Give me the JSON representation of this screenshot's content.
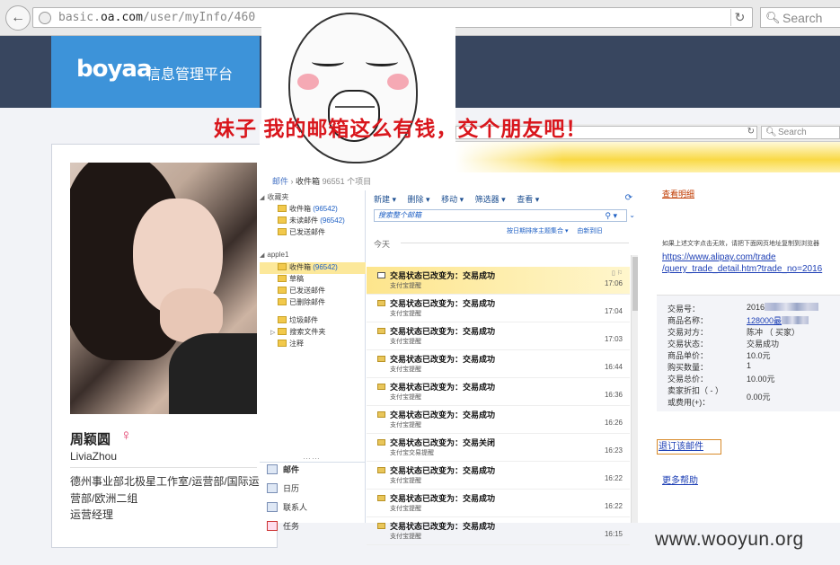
{
  "browser": {
    "url_prefix": "basic.",
    "url_domain": "oa.com",
    "url_path": "/user/myInfo/460",
    "search_placeholder": "Search"
  },
  "header": {
    "brand": "boyaa",
    "title": "信息管理平台"
  },
  "profile": {
    "name": "周颖圆",
    "gender_symbol": "♀",
    "english_name": "LiviaZhou",
    "department": "德州事业部北极星工作室/运营部/国际运营部/欧洲二组",
    "position": "运营经理"
  },
  "meme": {
    "caption": "妹子 我的邮箱这么有钱，交个朋友吧！"
  },
  "inner_browser": {
    "search_placeholder": "Search"
  },
  "outlook": {
    "breadcrumb": {
      "part1": "邮件",
      "sep": "›",
      "part2": "收件箱",
      "count": "96551 个项目"
    },
    "nav": {
      "favorites_label": "收藏夹",
      "inbox": "收件箱",
      "inbox_count": "(96542)",
      "unread": "未读邮件",
      "unread_count": "(96542)",
      "sent": "已发送邮件",
      "account": "apple1",
      "acc_inbox": "收件箱",
      "acc_inbox_count": "(96542)",
      "drafts": "草稿",
      "acc_sent": "已发送邮件",
      "deleted": "已删除邮件",
      "junk": "垃圾邮件",
      "search_folders": "搜索文件夹",
      "notes": "注释"
    },
    "modules": {
      "dots": "……",
      "mail": "邮件",
      "calendar": "日历",
      "contacts": "联系人",
      "tasks": "任务"
    },
    "toolbar": {
      "new": "新建 ▾",
      "delete": "删除 ▾",
      "move": "移动 ▾",
      "filter": "筛选器 ▾",
      "view": "查看 ▾"
    },
    "search_placeholder": "搜索整个邮箱",
    "sort": {
      "by": "按日期排序主题集合 ▾",
      "order": "由新到旧"
    },
    "today_label": "今天",
    "mails": [
      {
        "subject": "交易状态已改变为：交易成功",
        "from": "支付宝提醒",
        "time": "17:06"
      },
      {
        "subject": "交易状态已改变为：交易成功",
        "from": "支付宝提醒",
        "time": "17:04"
      },
      {
        "subject": "交易状态已改变为：交易成功",
        "from": "支付宝提醒",
        "time": "17:03"
      },
      {
        "subject": "交易状态已改变为：交易成功",
        "from": "支付宝提醒",
        "time": "16:44"
      },
      {
        "subject": "交易状态已改变为：交易成功",
        "from": "支付宝提醒",
        "time": "16:36"
      },
      {
        "subject": "交易状态已改变为：交易成功",
        "from": "支付宝提醒",
        "time": "16:26"
      },
      {
        "subject": "交易状态已改变为：交易关闭",
        "from": "支付宝交易提醒",
        "time": "16:23"
      },
      {
        "subject": "交易状态已改变为：交易成功",
        "from": "支付宝提醒",
        "time": "16:22"
      },
      {
        "subject": "交易状态已改变为：交易成功",
        "from": "支付宝提醒",
        "time": "16:22"
      },
      {
        "subject": "交易状态已改变为：交易成功",
        "from": "支付宝提醒",
        "time": "16:15"
      }
    ]
  },
  "alipay": {
    "view_detail": "查看明细",
    "note": "如果上述文字点击无效，请把下面网页地址复制到浏览器",
    "url_line1": "https://www.alipay.com/trade",
    "url_line2": "/query_trade_detail.htm?trade_no=2016",
    "details": [
      {
        "label": "交易号：",
        "value": "2016"
      },
      {
        "label": "商品名称：",
        "value": "128000",
        "suffix": "最"
      },
      {
        "label": "交易对方：",
        "value": "陈冲 （ 买家）"
      },
      {
        "label": "交易状态：",
        "value": "交易成功"
      },
      {
        "label": "商品单价：",
        "value": "10.0元"
      },
      {
        "label": "购买数量：",
        "value": "1"
      },
      {
        "label": "交易总价：",
        "value": "10.00元"
      },
      {
        "label": "卖家折扣（ - ）",
        "value": "0.00元"
      },
      {
        "label": "或费用(+)：",
        "value": ""
      }
    ],
    "refund": "退订该邮件",
    "help": "更多帮助"
  },
  "watermark": "www.wooyun.org"
}
